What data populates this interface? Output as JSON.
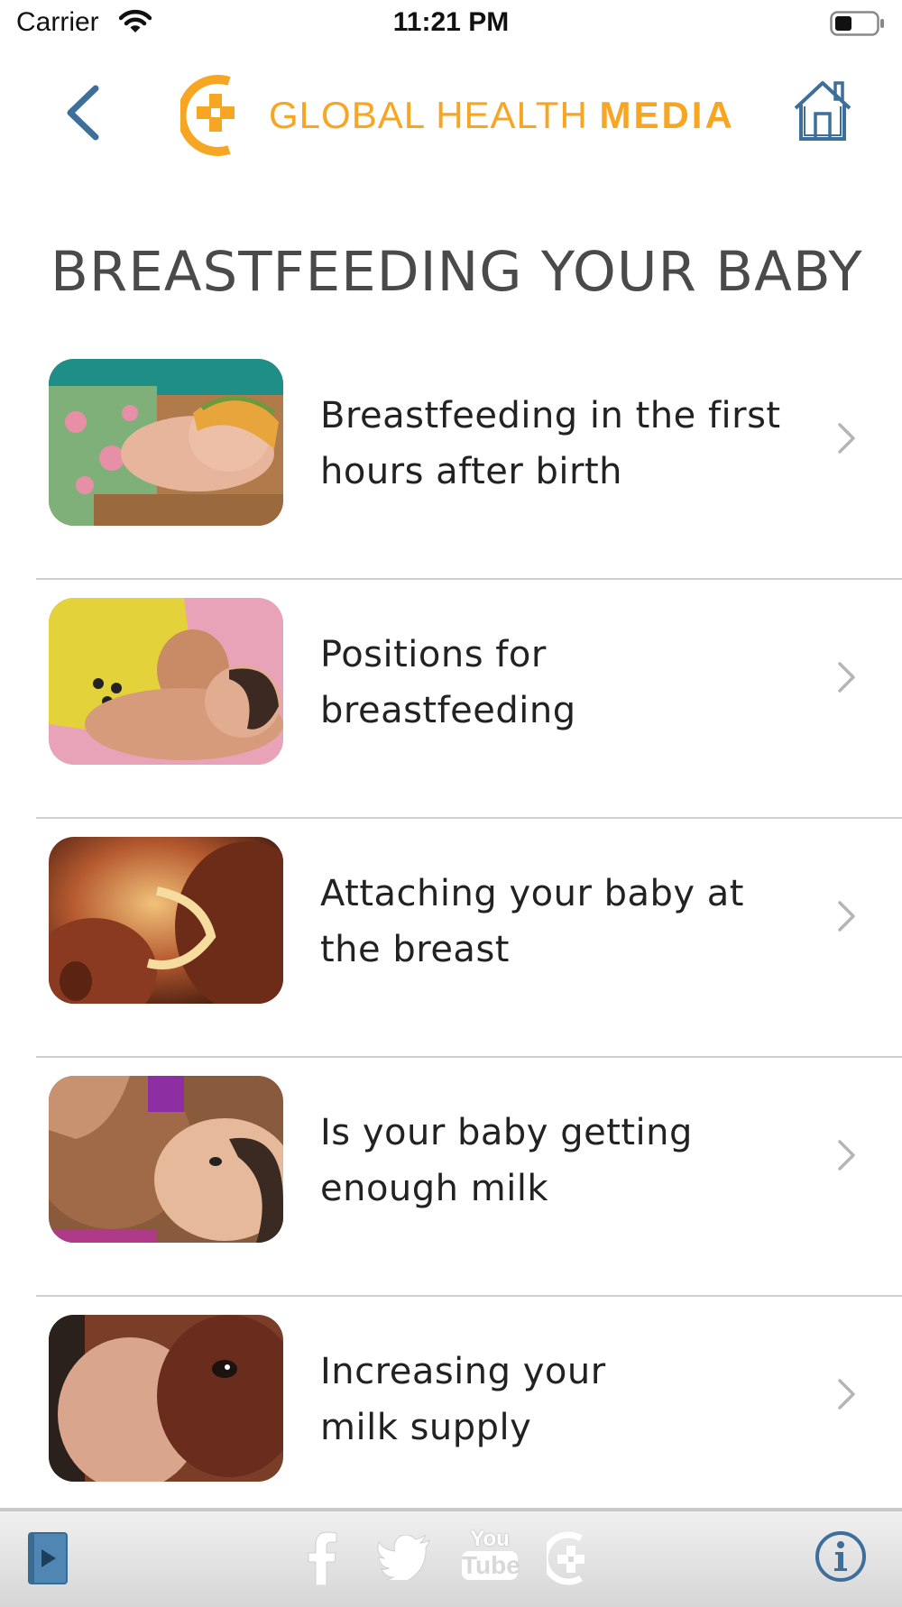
{
  "status_bar": {
    "carrier": "Carrier",
    "time": "11:21 PM"
  },
  "header": {
    "logo_text_regular": "GLOBAL HEALTH ",
    "logo_text_bold": "MEDIA",
    "brand_color": "#f6a623",
    "nav_icon_color": "#3e6f9b"
  },
  "page": {
    "title": "BREASTFEEDING YOUR BABY"
  },
  "items": [
    {
      "line1": "Breastfeeding in the first",
      "line2": "hours after birth",
      "thumb_icon": "newborn-on-chest-photo"
    },
    {
      "line1": "Positions for",
      "line2": "breastfeeding",
      "thumb_icon": "breastfeeding-position-photo"
    },
    {
      "line1": "Attaching your baby at",
      "line2": "the breast",
      "thumb_icon": "attachment-illustration-photo"
    },
    {
      "line1": "Is your baby getting",
      "line2": "enough milk",
      "thumb_icon": "baby-feeding-photo"
    },
    {
      "line1": "Increasing your",
      "line2": "milk supply",
      "thumb_icon": "baby-closeup-photo"
    }
  ],
  "tab_bar": {
    "icons": [
      "video-library-icon",
      "facebook-icon",
      "twitter-icon",
      "youtube-icon",
      "global-health-media-icon",
      "info-icon"
    ],
    "youtube_top": "You",
    "youtube_bottom": "Tube"
  }
}
